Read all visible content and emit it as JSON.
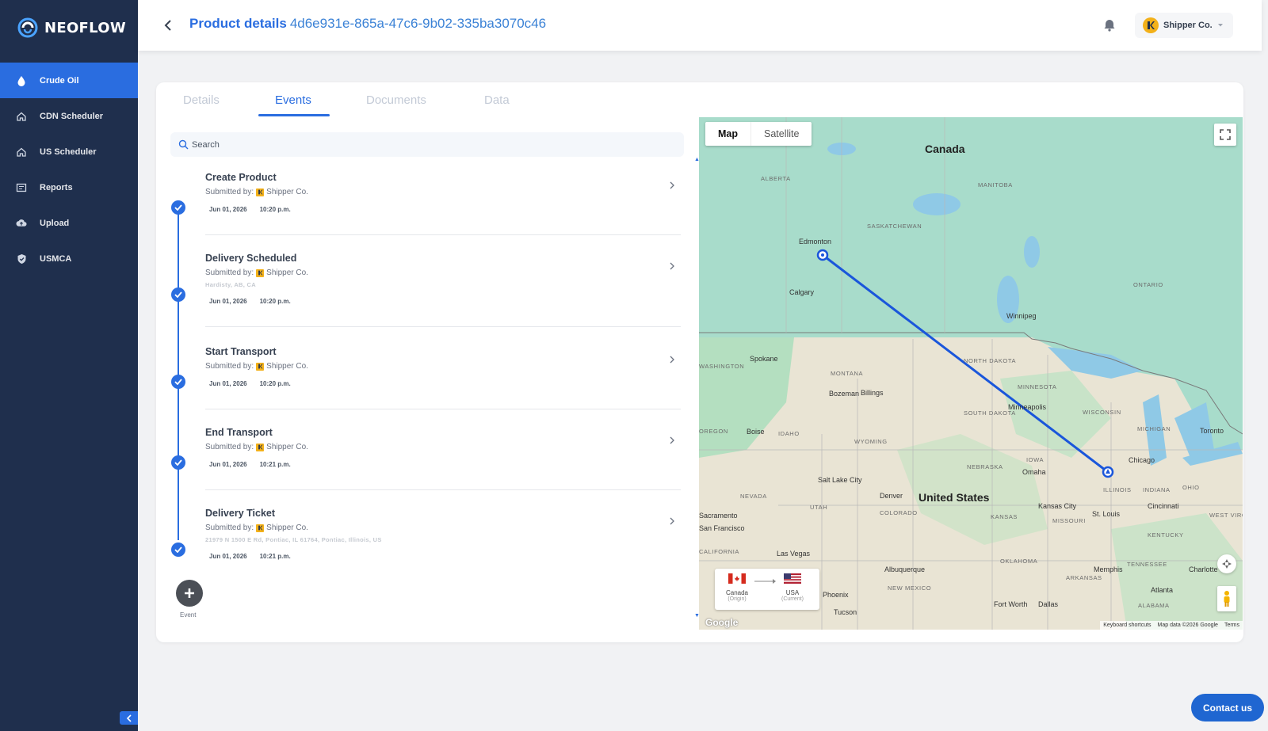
{
  "brand": {
    "name": "NEOFLOW"
  },
  "sidebar": {
    "items": [
      {
        "label": "Crude Oil",
        "icon": "drop-icon",
        "active": true
      },
      {
        "label": "CDN Scheduler",
        "icon": "home-icon",
        "active": false
      },
      {
        "label": "US Scheduler",
        "icon": "home-icon",
        "active": false
      },
      {
        "label": "Reports",
        "icon": "reports-icon",
        "active": false
      },
      {
        "label": "Upload",
        "icon": "cloud-upload-icon",
        "active": false
      },
      {
        "label": "USMCA",
        "icon": "shield-icon",
        "active": false
      }
    ]
  },
  "header": {
    "title": "Product details",
    "product_id": "4d6e931e-865a-47c6-9b02-335ba3070c46",
    "user": "Shipper Co."
  },
  "tabs": [
    {
      "label": "Details",
      "active": false
    },
    {
      "label": "Events",
      "active": true
    },
    {
      "label": "Documents",
      "active": false
    },
    {
      "label": "Data",
      "active": false
    }
  ],
  "search": {
    "placeholder": "Search"
  },
  "events": [
    {
      "title": "Create Product",
      "submitted_label": "Submitted by:",
      "submitter": "Shipper Co.",
      "address": "",
      "date": "Jun 01, 2026",
      "time": "10:20 p.m."
    },
    {
      "title": "Delivery Scheduled",
      "submitted_label": "Submitted by:",
      "submitter": "Shipper Co.",
      "address": "Hardisty, AB, CA",
      "date": "Jun 01, 2026",
      "time": "10:20 p.m."
    },
    {
      "title": "Start Transport",
      "submitted_label": "Submitted by:",
      "submitter": "Shipper Co.",
      "address": "",
      "date": "Jun 01, 2026",
      "time": "10:20 p.m."
    },
    {
      "title": "End Transport",
      "submitted_label": "Submitted by:",
      "submitter": "Shipper Co.",
      "address": "",
      "date": "Jun 01, 2026",
      "time": "10:21 p.m."
    },
    {
      "title": "Delivery Ticket",
      "submitted_label": "Submitted by:",
      "submitter": "Shipper Co.",
      "address": "21979 N 1500 E Rd, Pontiac, IL 61764, Pontiac, Illinois, US",
      "date": "Jun 01, 2026",
      "time": "10:21 p.m."
    }
  ],
  "add_event": {
    "label": "Event"
  },
  "map": {
    "toggle": {
      "map": "Map",
      "satellite": "Satellite"
    },
    "countries": {
      "canada": "Canada",
      "us": "United States"
    },
    "states": [
      "ALBERTA",
      "SASKATCHEWAN",
      "MANITOBA",
      "ONTARIO",
      "MONTANA",
      "NORTH DAKOTA",
      "MINNESOTA",
      "WISCONSIN",
      "MICHIGAN",
      "SOUTH DAKOTA",
      "IDAHO",
      "WYOMING",
      "NEBRASKA",
      "IOWA",
      "ILLINOIS",
      "INDIANA",
      "OHIO",
      "NEVADA",
      "UTAH",
      "COLORADO",
      "KANSAS",
      "MISSOURI",
      "KENTUCKY",
      "OKLAHOMA",
      "ARKANSAS",
      "TENNESSEE",
      "NEW MEXICO",
      "ALABAMA",
      "CALIFORNIA",
      "OREGON",
      "WEST VIRGINIA",
      "WASHINGTON"
    ],
    "cities": [
      "Edmonton",
      "Calgary",
      "Winnipeg",
      "Minneapolis",
      "Chicago",
      "Toronto",
      "Spokane",
      "Bozeman",
      "Billings",
      "Boise",
      "Omaha",
      "Denver",
      "Salt Lake City",
      "Kansas City",
      "St. Louis",
      "Cincinnati",
      "Las Vegas",
      "Albuquerque",
      "Phoenix",
      "Tucson",
      "Fort Worth",
      "Dallas",
      "Memphis",
      "Atlanta",
      "Charlotte",
      "Sacramento",
      "San Francisco"
    ],
    "route_legend": {
      "origin_country": "Canada",
      "origin_role": "(Origin)",
      "current_country": "USA",
      "current_role": "(Current)"
    },
    "google": "Google",
    "footer": {
      "shortcuts": "Keyboard shortcuts",
      "data": "Map data ©2026 Google",
      "terms": "Terms"
    }
  },
  "contact": {
    "label": "Contact us"
  },
  "colors": {
    "sidebar": "#1f2f4d",
    "accent": "#2a6de0",
    "route": "#1a56db"
  }
}
